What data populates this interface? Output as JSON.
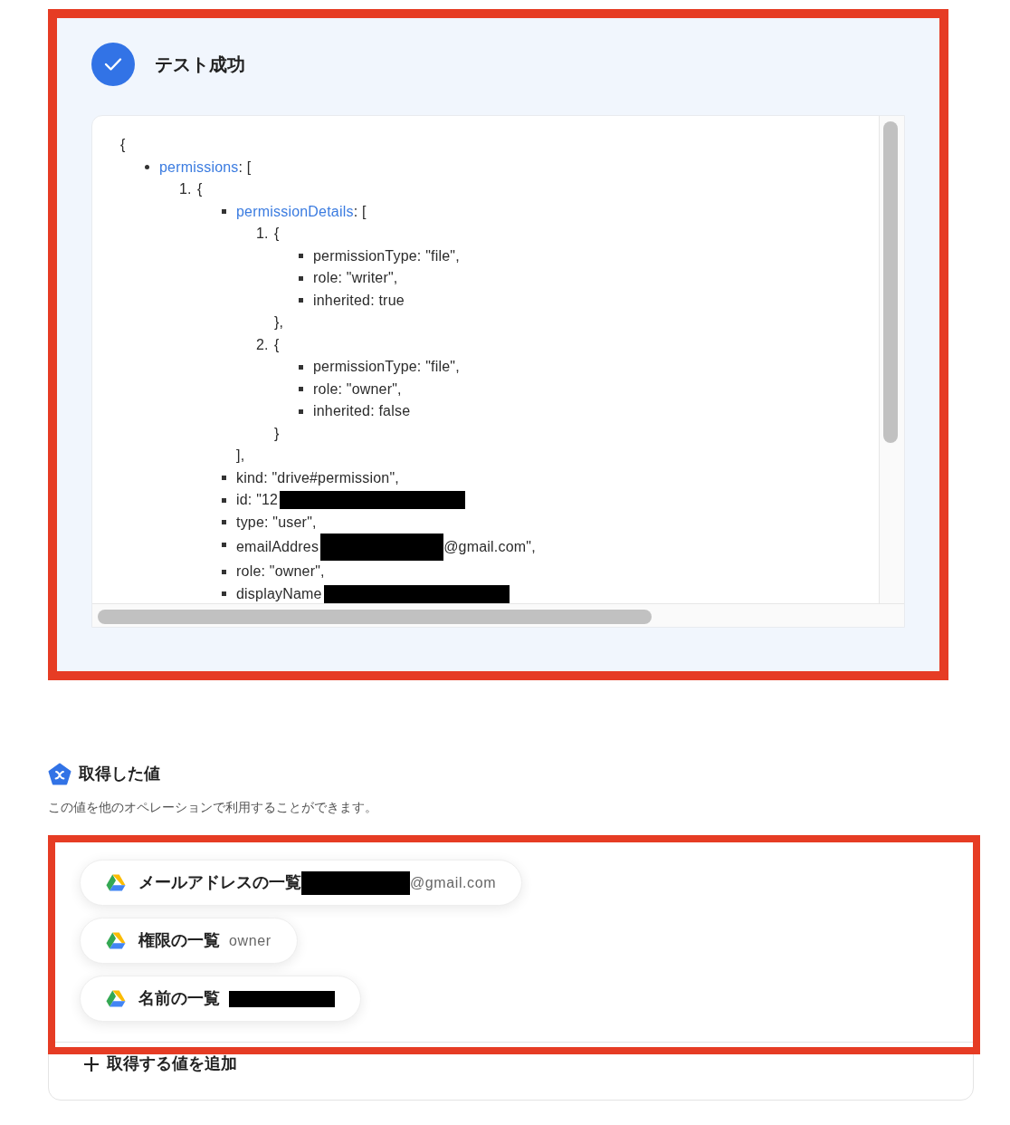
{
  "result": {
    "title": "テスト成功",
    "code": {
      "open": "{",
      "children": [
        {
          "kind": "array",
          "key": "permissions",
          "open": ": [",
          "items": [
            {
              "kind": "object",
              "number": "1.",
              "open": "{",
              "children": [
                {
                  "kind": "array",
                  "key": "permissionDetails",
                  "open": ": [",
                  "items": [
                    {
                      "kind": "object",
                      "number": "1.",
                      "open": "{",
                      "children": [
                        {
                          "kind": "field",
                          "text": "permissionType: \"file\","
                        },
                        {
                          "kind": "field",
                          "text": "role: \"writer\","
                        },
                        {
                          "kind": "field",
                          "text": "inherited: true"
                        }
                      ],
                      "close": "},"
                    },
                    {
                      "kind": "object",
                      "number": "2.",
                      "open": "{",
                      "children": [
                        {
                          "kind": "field",
                          "text": "permissionType: \"file\","
                        },
                        {
                          "kind": "field",
                          "text": "role: \"owner\","
                        },
                        {
                          "kind": "field",
                          "text": "inherited: false"
                        }
                      ],
                      "close": "}"
                    }
                  ],
                  "close": "],"
                },
                {
                  "kind": "field",
                  "text": "kind: \"drive#permission\","
                },
                {
                  "kind": "field",
                  "text": "id: \"12",
                  "redacted": true
                },
                {
                  "kind": "field",
                  "text": "type: \"user\","
                },
                {
                  "kind": "field",
                  "text": "emailAddres",
                  "redacted": true,
                  "after": "@gmail.com\","
                },
                {
                  "kind": "field",
                  "text": "role: \"owner\","
                },
                {
                  "kind": "field",
                  "text": "displayName",
                  "redacted": true
                }
              ]
            }
          ]
        }
      ]
    }
  },
  "values": {
    "title": "取得した値",
    "description": "この値を他のオペレーションで利用することができます。",
    "chips": [
      {
        "label": "メールアドレスの一覧",
        "redacted": true,
        "value": "@gmail.com"
      },
      {
        "label": "権限の一覧",
        "redacted": false,
        "value": "owner"
      },
      {
        "label": "名前の一覧",
        "redacted": true
      }
    ],
    "add_button": "取得する値を追加"
  }
}
